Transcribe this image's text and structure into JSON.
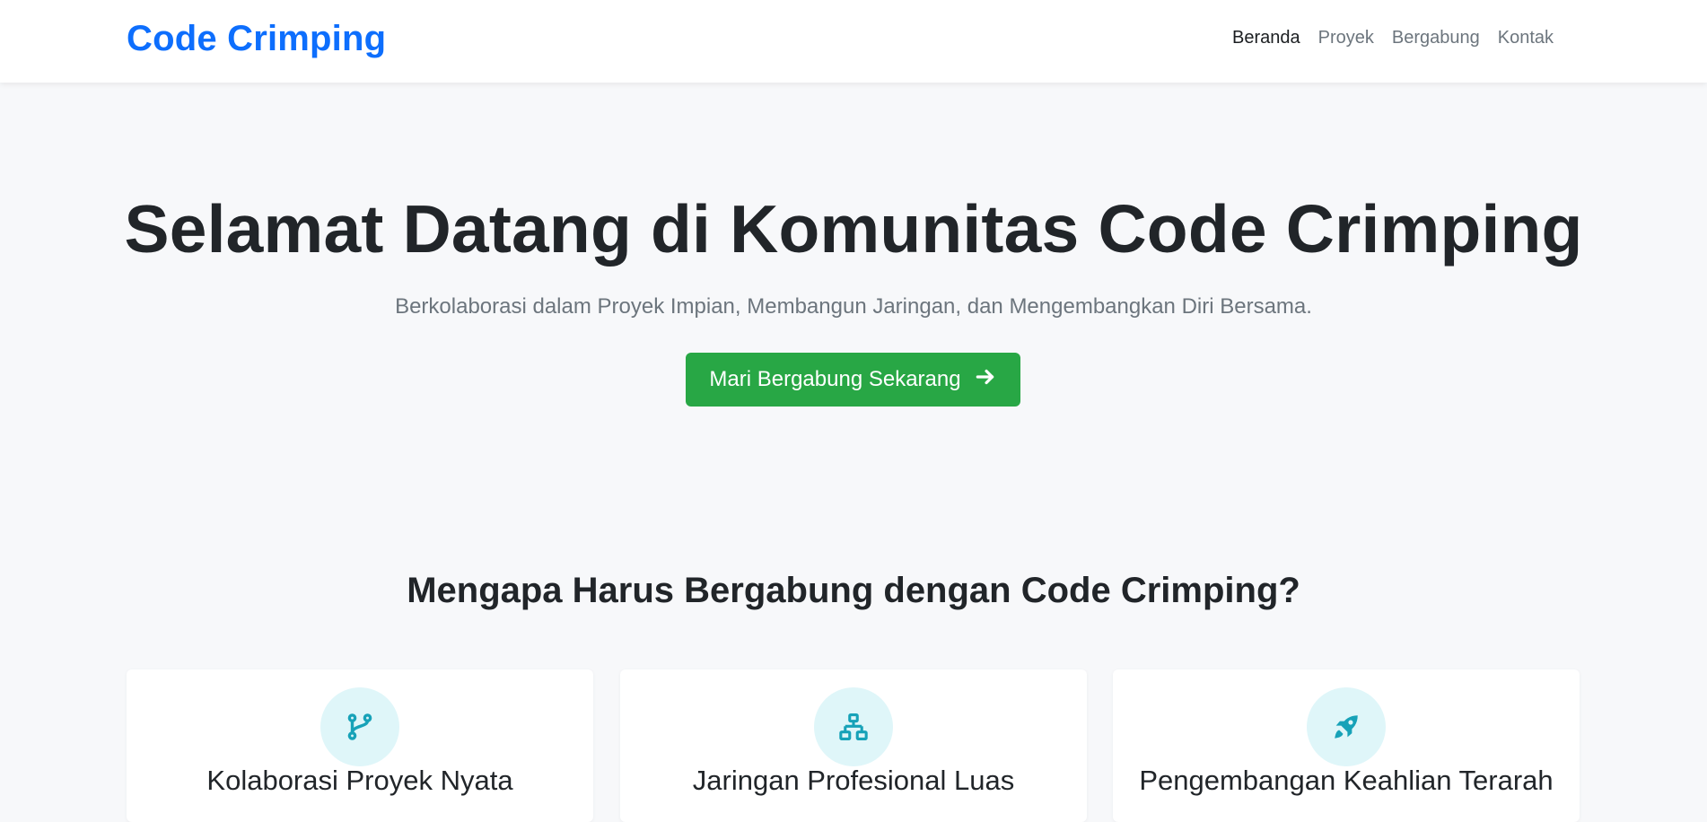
{
  "navbar": {
    "brand": "Code Crimping",
    "links": [
      {
        "label": "Beranda",
        "active": true
      },
      {
        "label": "Proyek",
        "active": false
      },
      {
        "label": "Bergabung",
        "active": false
      },
      {
        "label": "Kontak",
        "active": false
      }
    ]
  },
  "hero": {
    "title": "Selamat Datang di Komunitas Code Crimping",
    "subtitle": "Berkolaborasi dalam Proyek Impian, Membangun Jaringan, dan Mengembangkan Diri Bersama.",
    "cta_label": "Mari Bergabung Sekarang",
    "cta_icon": "arrow-right-icon"
  },
  "features": {
    "title": "Mengapa Harus Bergabung dengan Code Crimping?",
    "cards": [
      {
        "title": "Kolaborasi Proyek Nyata",
        "icon": "code-branch-icon"
      },
      {
        "title": "Jaringan Profesional Luas",
        "icon": "network-icon"
      },
      {
        "title": "Pengembangan Keahlian Terarah",
        "icon": "rocket-icon"
      }
    ]
  },
  "colors": {
    "brand": "#0d6efd",
    "cta": "#28a745",
    "icon_accent": "#17a2b8",
    "icon_bg": "#dff6f9",
    "page_bg": "#f7f8fa"
  }
}
